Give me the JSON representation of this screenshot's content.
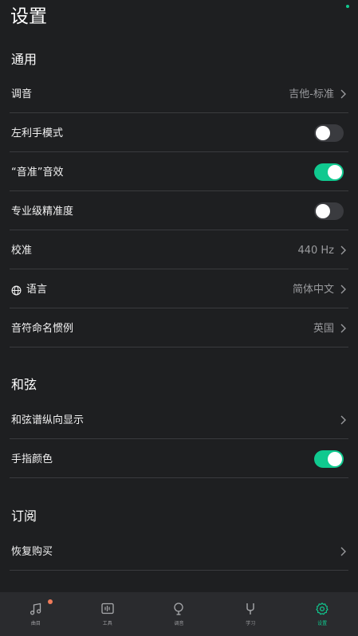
{
  "page": {
    "title": "设置"
  },
  "colors": {
    "accent": "#10c98f",
    "background": "#1e1f21",
    "badge": "#f07b5a"
  },
  "sections": {
    "general": {
      "title": "通用",
      "tuning": {
        "label": "调音",
        "value": "吉他-标准"
      },
      "left_hand": {
        "label": "左利手模式",
        "enabled": false
      },
      "in_tune_sound": {
        "label": "“音准”音效",
        "enabled": true
      },
      "pro_precision": {
        "label": "专业级精准度",
        "enabled": false
      },
      "calibration": {
        "label": "校准",
        "value": "440 Hz"
      },
      "language": {
        "label": "语言",
        "value": "简体中文",
        "icon": "globe-icon"
      },
      "note_naming": {
        "label": "音符命名惯例",
        "value": "英国"
      }
    },
    "chords": {
      "title": "和弦",
      "vertical_display": {
        "label": "和弦谱纵向显示"
      },
      "finger_colors": {
        "label": "手指颜色",
        "enabled": true
      }
    },
    "subscription": {
      "title": "订阅",
      "restore": {
        "label": "恢复购买"
      }
    }
  },
  "tabbar": {
    "tabs": [
      {
        "label": "曲目",
        "icon": "music-note-icon",
        "active": false,
        "badge": true
      },
      {
        "label": "工具",
        "icon": "tools-icon",
        "active": false,
        "badge": false
      },
      {
        "label": "调音",
        "icon": "tuner-icon",
        "active": false,
        "badge": false
      },
      {
        "label": "学习",
        "icon": "learn-icon",
        "active": false,
        "badge": false
      },
      {
        "label": "设置",
        "icon": "gear-icon",
        "active": true,
        "badge": false
      }
    ]
  }
}
